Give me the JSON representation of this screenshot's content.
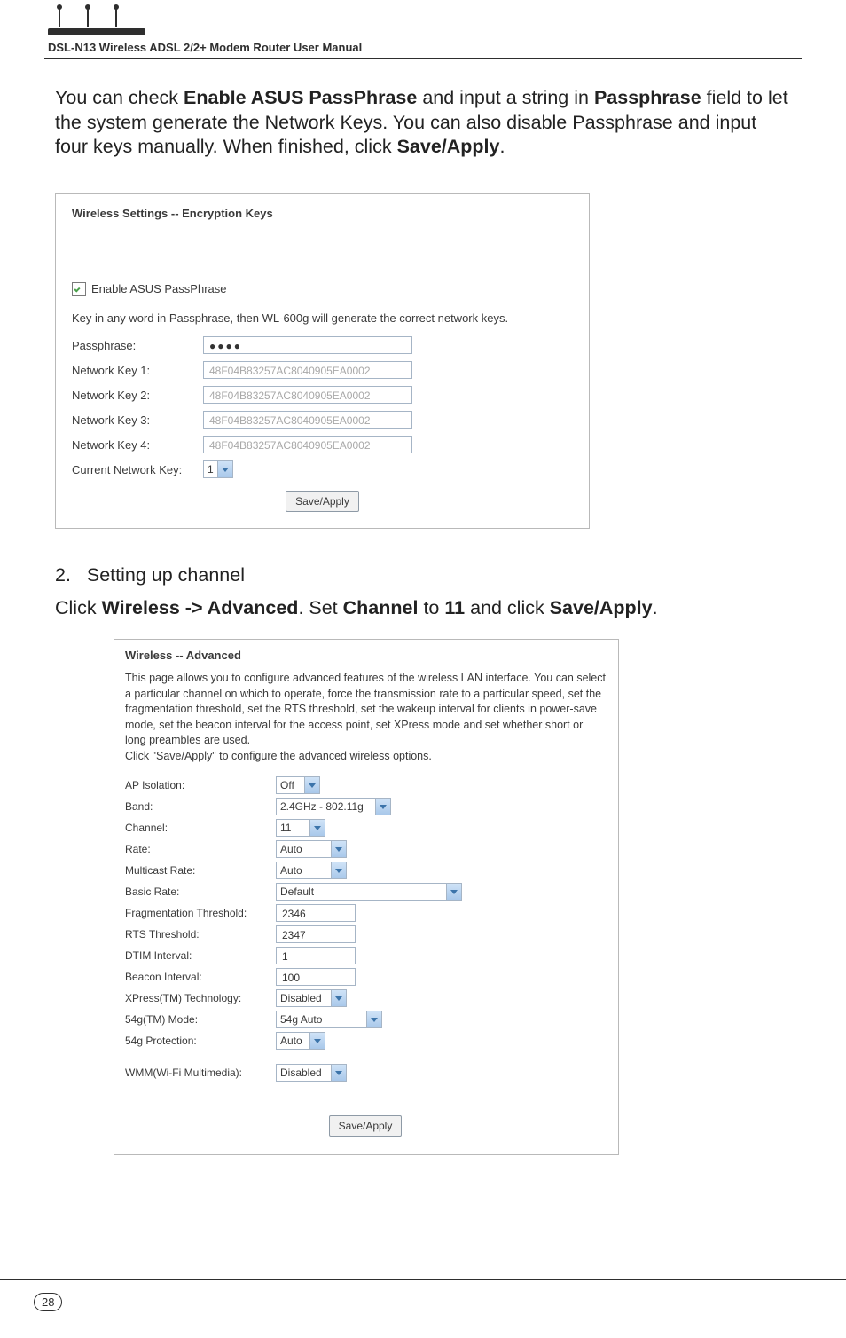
{
  "header": {
    "title": "DSL-N13 Wireless ADSL 2/2+ Modem Router User Manual"
  },
  "intro": {
    "prefix": "You can check ",
    "b1": "Enable ASUS PassPhrase",
    "mid1": " and input a string in ",
    "b2": "Passphrase",
    "mid2": " field to let the system generate the Network Keys. You can also disable Passphrase and input four keys manually. When finished, click ",
    "b3": "Save/Apply",
    "suffix": "."
  },
  "panel1": {
    "title": "Wireless Settings -- Encryption Keys",
    "enable_label": "Enable ASUS PassPhrase",
    "desc": "Key in any word in Passphrase, then WL-600g will generate the correct network keys.",
    "rows": {
      "pass_k": "Passphrase:",
      "pass_v": "●●●●",
      "nk1_k": "Network Key 1:",
      "nk2_k": "Network Key 2:",
      "nk3_k": "Network Key 3:",
      "nk4_k": "Network Key 4:",
      "key_v": "48F04B83257AC8040905EA0002",
      "cnk_k": "Current Network Key:",
      "cnk_v": "1"
    },
    "save": "Save/Apply"
  },
  "section2": {
    "step_num": "2.",
    "step_text": "Setting up channel",
    "line_prefix": "Click ",
    "b1": "Wireless -> Advanced",
    "mid1": ". Set ",
    "b2": "Channel",
    "mid2": " to ",
    "b3": "11",
    "mid3": " and click ",
    "b4": "Save/Apply",
    "suffix": "."
  },
  "panel2": {
    "title": "Wireless -- Advanced",
    "desc": "This page allows you to configure advanced features of the wireless LAN interface. You can select a particular channel on which to operate, force the transmission rate to a particular speed, set the fragmentation threshold, set the RTS threshold, set the wakeup interval for clients in power-save mode, set the beacon interval for the access point, set XPress mode and set whether short or long preambles are used.",
    "desc2": "Click \"Save/Apply\" to configure the advanced wireless options.",
    "fields": {
      "ap_isolation_k": "AP Isolation:",
      "ap_isolation_v": "Off",
      "band_k": "Band:",
      "band_v": "2.4GHz - 802.11g",
      "channel_k": "Channel:",
      "channel_v": "11",
      "rate_k": "Rate:",
      "rate_v": "Auto",
      "mcrate_k": "Multicast Rate:",
      "mcrate_v": "Auto",
      "brate_k": "Basic Rate:",
      "brate_v": "Default",
      "frag_k": "Fragmentation Threshold:",
      "frag_v": "2346",
      "rts_k": "RTS Threshold:",
      "rts_v": "2347",
      "dtim_k": "DTIM Interval:",
      "dtim_v": "1",
      "beacon_k": "Beacon Interval:",
      "beacon_v": "100",
      "xpress_k": "XPress(TM) Technology:",
      "xpress_v": "Disabled",
      "g54m_k": "54g(TM) Mode:",
      "g54m_v": "54g Auto",
      "g54p_k": "54g Protection:",
      "g54p_v": "Auto",
      "wmm_k": "WMM(Wi-Fi Multimedia):",
      "wmm_v": "Disabled"
    },
    "save": "Save/Apply"
  },
  "footer": {
    "page": "28"
  }
}
